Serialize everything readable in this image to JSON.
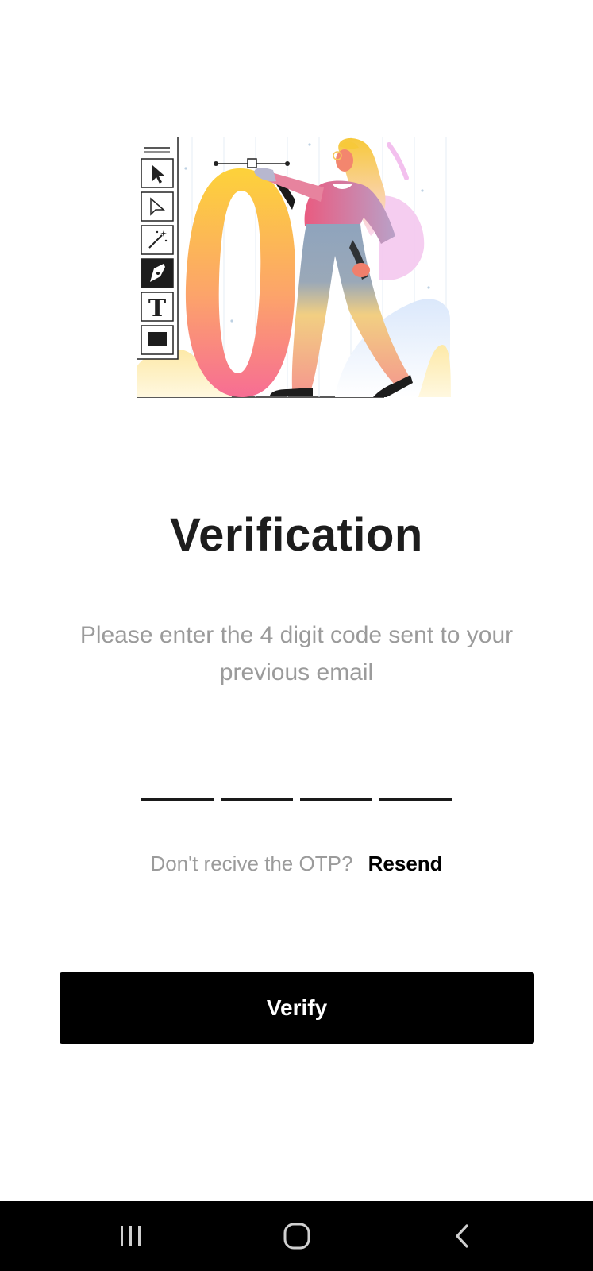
{
  "header": {
    "title": "Verification",
    "subtitle": "Please enter the 4 digit code sent to your previous email"
  },
  "illustration": {
    "icon": "designer-illustration",
    "tool_text_glyph": "T"
  },
  "otp": {
    "digits": [
      "",
      "",
      "",
      ""
    ]
  },
  "resend": {
    "prompt": "Don't recive the OTP?",
    "link_label": "Resend"
  },
  "actions": {
    "verify_label": "Verify"
  },
  "navbar": {
    "icons": [
      "recent-apps-icon",
      "home-icon",
      "back-icon"
    ]
  },
  "colors": {
    "primary": "#000000",
    "background": "#ffffff",
    "muted_text": "#9b9b9b"
  }
}
